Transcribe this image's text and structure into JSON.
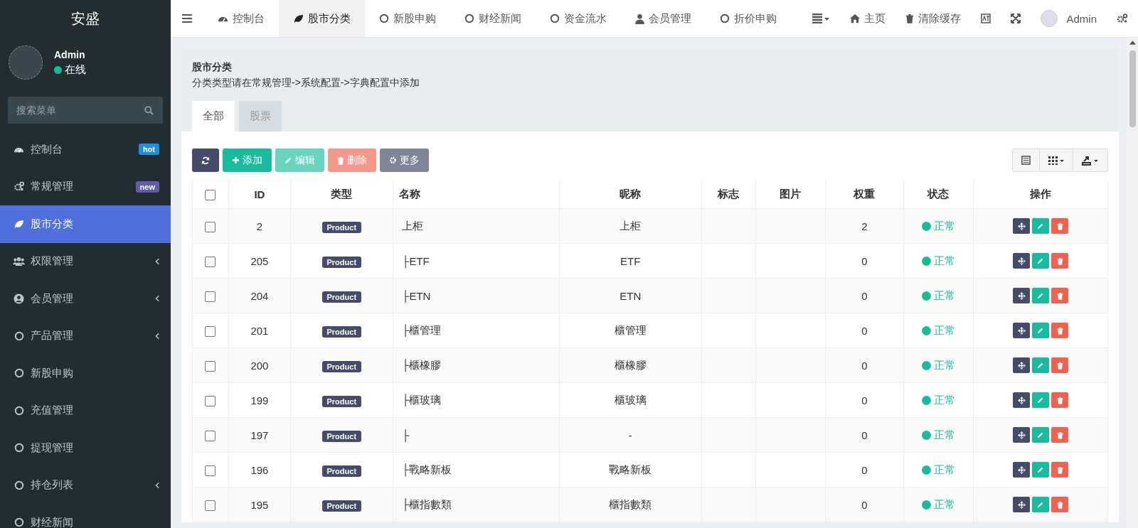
{
  "sidebar": {
    "brand": "安盛",
    "user": {
      "name": "Admin",
      "status": "在线"
    },
    "search": {
      "placeholder": "搜索菜单"
    },
    "items": [
      {
        "label": "控制台",
        "selected": false,
        "expandable": false,
        "badge": {
          "text": "hot",
          "color": "#1e8ee0"
        }
      },
      {
        "label": "常规管理",
        "selected": false,
        "expandable": false,
        "badge": {
          "text": "new",
          "color": "#605ca8"
        }
      },
      {
        "label": "股市分类",
        "selected": true,
        "expandable": false
      },
      {
        "label": "权限管理",
        "selected": false,
        "expandable": true
      },
      {
        "label": "会员管理",
        "selected": false,
        "expandable": true
      },
      {
        "label": "产品管理",
        "selected": false,
        "expandable": true
      },
      {
        "label": "新股申购",
        "selected": false,
        "expandable": false
      },
      {
        "label": "充值管理",
        "selected": false,
        "expandable": false
      },
      {
        "label": "提现管理",
        "selected": false,
        "expandable": false
      },
      {
        "label": "持仓列表",
        "selected": false,
        "expandable": true
      },
      {
        "label": "财经新闻",
        "selected": false,
        "expandable": false
      }
    ]
  },
  "topbar": {
    "tabs": [
      {
        "label": "控制台",
        "selected": false
      },
      {
        "label": "股市分类",
        "selected": true
      },
      {
        "label": "新股申购",
        "selected": false
      },
      {
        "label": "财经新闻",
        "selected": false
      },
      {
        "label": "资金流水",
        "selected": false
      },
      {
        "label": "会员管理",
        "selected": false
      },
      {
        "label": "折价申购",
        "selected": false
      }
    ],
    "links": [
      {
        "label": "主页"
      },
      {
        "label": "清除缓存"
      }
    ],
    "user": "Admin"
  },
  "panel": {
    "title": "股市分类",
    "subtitle": "分类类型请在常规管理->系统配置->字典配置中添加",
    "tabs": [
      {
        "label": "全部",
        "selected": true
      },
      {
        "label": "股票",
        "selected": false
      }
    ],
    "toolbar": [
      {
        "kind": "refresh",
        "disabled": false
      },
      {
        "kind": "add",
        "label": "添加",
        "disabled": false
      },
      {
        "kind": "edit",
        "label": "编辑",
        "disabled": true
      },
      {
        "kind": "delete",
        "label": "删除",
        "disabled": true
      },
      {
        "kind": "more",
        "label": "更多",
        "disabled": false
      }
    ],
    "table": {
      "select_all": {
        "checked": false
      },
      "columns": [
        "ID",
        "类型",
        "名称",
        "昵称",
        "标志",
        "图片",
        "权重",
        "状态",
        "操作"
      ],
      "rows": [
        {
          "checked": false,
          "id": "2",
          "type": "Product",
          "name": "上柜",
          "nickname": "上柜",
          "weight": "2",
          "status": "正常"
        },
        {
          "checked": false,
          "id": "205",
          "type": "Product",
          "name": "├ETF",
          "nickname": "ETF",
          "weight": "0",
          "status": "正常"
        },
        {
          "checked": false,
          "id": "204",
          "type": "Product",
          "name": "├ETN",
          "nickname": "ETN",
          "weight": "0",
          "status": "正常"
        },
        {
          "checked": false,
          "id": "201",
          "type": "Product",
          "name": "├櫃管理",
          "nickname": "櫃管理",
          "weight": "0",
          "status": "正常"
        },
        {
          "checked": false,
          "id": "200",
          "type": "Product",
          "name": "├櫃橡膠",
          "nickname": "櫃橡膠",
          "weight": "0",
          "status": "正常"
        },
        {
          "checked": false,
          "id": "199",
          "type": "Product",
          "name": "├櫃玻璃",
          "nickname": "櫃玻璃",
          "weight": "0",
          "status": "正常"
        },
        {
          "checked": false,
          "id": "197",
          "type": "Product",
          "name": "├",
          "nickname": "-",
          "weight": "0",
          "status": "正常"
        },
        {
          "checked": false,
          "id": "196",
          "type": "Product",
          "name": "├戰略新板",
          "nickname": "戰略新板",
          "weight": "0",
          "status": "正常"
        },
        {
          "checked": false,
          "id": "195",
          "type": "Product",
          "name": "├櫃指數類",
          "nickname": "櫃指數類",
          "weight": "0",
          "status": "正常"
        }
      ]
    }
  }
}
